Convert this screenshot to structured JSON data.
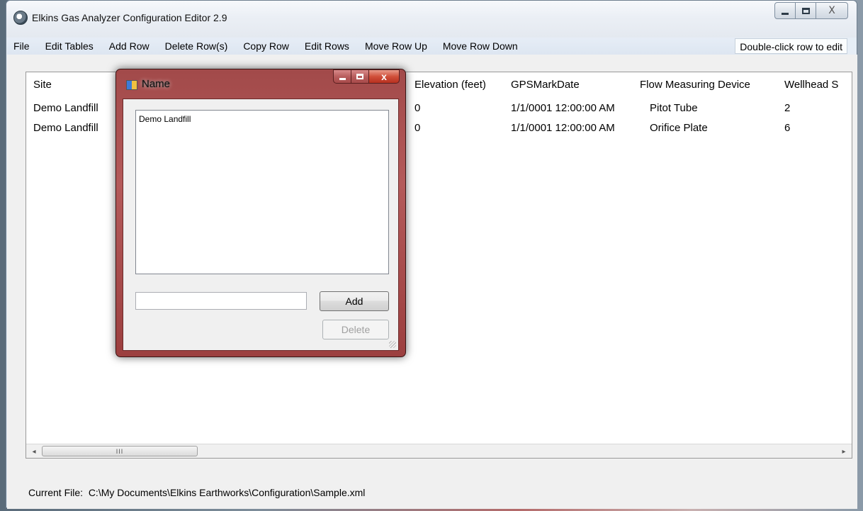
{
  "window": {
    "title": "Elkins Gas Analyzer Configuration Editor 2.9",
    "close_glyph": "X"
  },
  "menu": {
    "items": [
      "File",
      "Edit Tables",
      "Add Row",
      "Delete Row(s)",
      "Copy Row",
      "Edit Rows",
      "Move Row Up",
      "Move Row Down"
    ],
    "hint": "Double-click row to edit"
  },
  "grid": {
    "columns": [
      "Site",
      "Elevation (feet)",
      "GPSMarkDate",
      "Flow Measuring Device",
      "Wellhead S"
    ],
    "rows": [
      [
        "Demo Landfill",
        "0",
        "1/1/0001 12:00:00 AM",
        "Pitot Tube",
        "2"
      ],
      [
        "Demo Landfill",
        "0",
        "1/1/0001 12:00:00 AM",
        "Orifice Plate",
        "6"
      ]
    ],
    "scroll_grip": "III",
    "scroll_left": "◂",
    "scroll_right": "▸"
  },
  "status": {
    "label": "Current File:",
    "path": "C:\\My Documents\\Elkins Earthworks\\Configuration\\Sample.xml"
  },
  "dialog": {
    "title": "Name",
    "list_items": [
      "Demo Landfill"
    ],
    "input_value": "",
    "add_label": "Add",
    "delete_label": "Delete",
    "close_glyph": "x"
  },
  "colors": {
    "dialog_frame": "#a24a4a",
    "window_frame": "#e4e9f0"
  }
}
